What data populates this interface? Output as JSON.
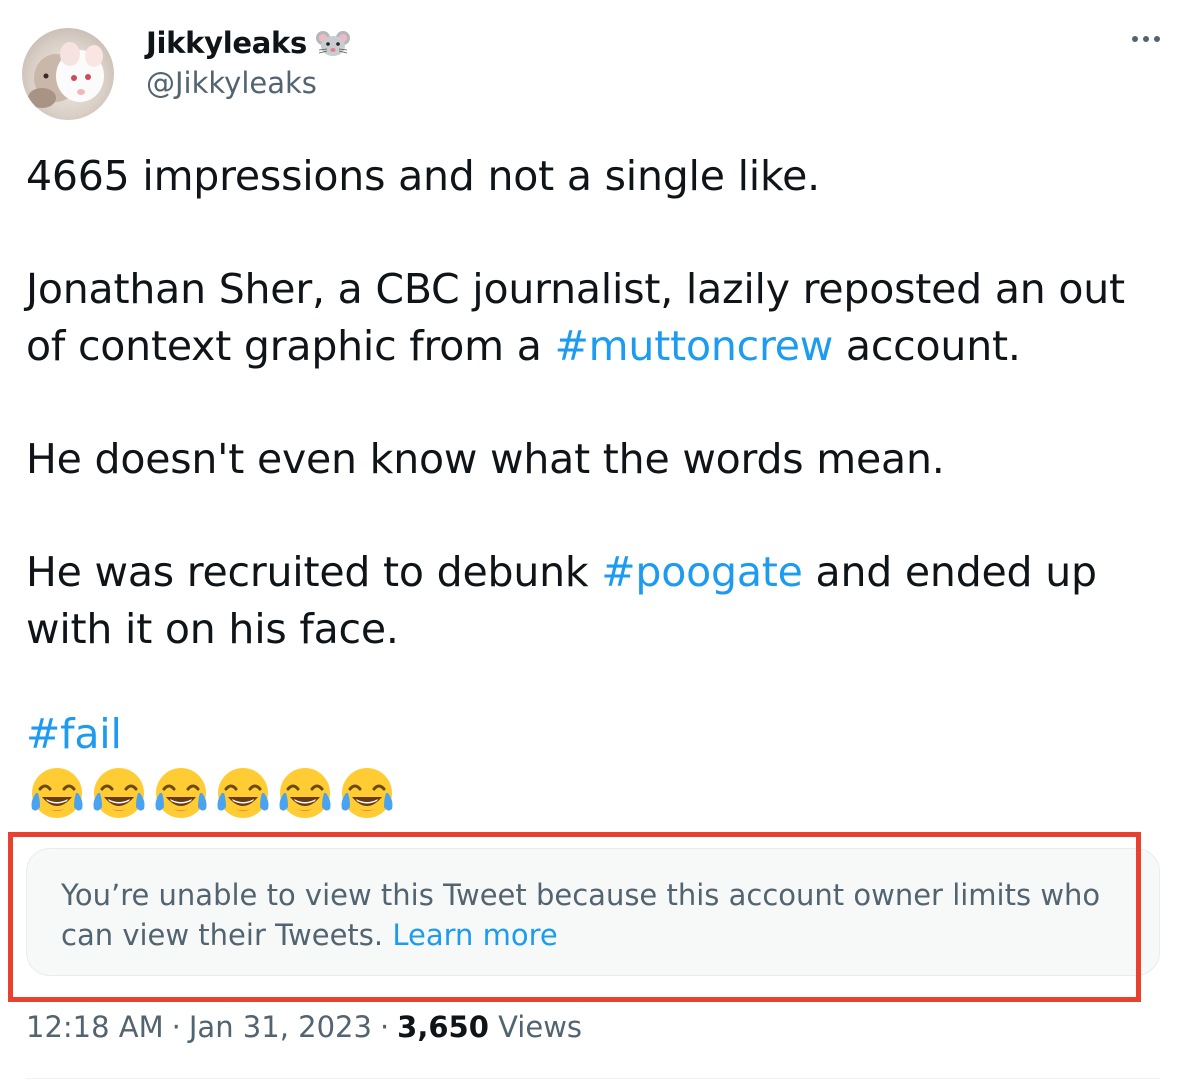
{
  "author": {
    "display_name": "Jikkyleaks",
    "handle": "@Jikkyleaks",
    "name_emoji": "rat-face-emoji"
  },
  "menu": {
    "more_icon": "more-horizontal-icon"
  },
  "tweet": {
    "p1": "4665 impressions and not a single like.",
    "p2_a": "Jonathan Sher, a CBC journalist, lazily reposted an out of context graphic from a ",
    "p2_tag": "#muttoncrew",
    "p2_b": " account.",
    "p3": "He doesn't even know what the words mean.",
    "p4_a": "He was recruited to debunk ",
    "p4_tag": "#poogate",
    "p4_b": " and ended up with it on his face.",
    "p5_tag": "#fail",
    "emoji_count": 6,
    "emoji": "face-with-tears-of-joy"
  },
  "quoted_notice": {
    "text": "You’re unable to view this Tweet because this account owner limits who can view their Tweets. ",
    "link": "Learn more"
  },
  "highlight": {
    "color": "#e8412f"
  },
  "meta": {
    "time": "12:18 AM",
    "sep1": "·",
    "date": "Jan 31, 2023",
    "sep2": "·",
    "views_count": "3,650",
    "views_label": "Views"
  },
  "colors": {
    "accent": "#1d9bf0",
    "secondary": "#536471",
    "text": "#0f1419"
  }
}
